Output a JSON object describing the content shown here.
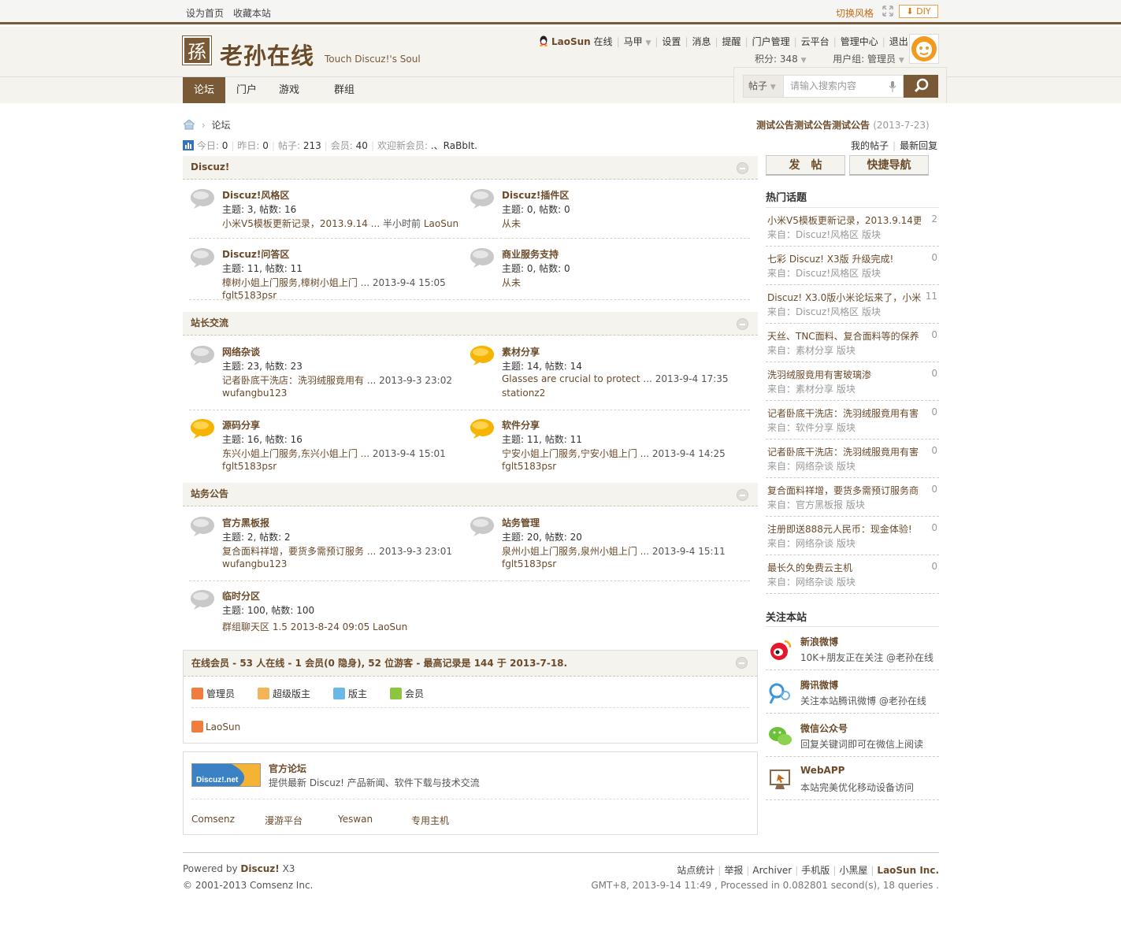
{
  "topbar": {
    "set_home": "设为首页",
    "bookmark": "收藏本站",
    "switch_style": "切换风格",
    "diy": "DIY"
  },
  "header": {
    "logo_char": "孫",
    "site_name": "老孙在线",
    "slogan": "Touch Discuz!'s Soul"
  },
  "usernav": {
    "username": "LaoSun",
    "status": "在线",
    "items": [
      "马甲",
      "设置",
      "消息",
      "提醒",
      "门户管理",
      "云平台",
      "管理中心",
      "退出"
    ],
    "points": "积分: 348",
    "group": "用户组: 管理员"
  },
  "nav": {
    "items": [
      "论坛",
      "门户",
      "游戏",
      "群组"
    ]
  },
  "search": {
    "type": "帖子",
    "placeholder": "请输入搜索内容"
  },
  "breadcrumb": {
    "current": "论坛"
  },
  "announcement": {
    "text": "测试公告测试公告测试公告",
    "date": "(2013-7-23)"
  },
  "stats": {
    "today_label": "今日:",
    "today": "0",
    "yesterday_label": "昨日:",
    "yesterday": "0",
    "posts_label": "帖子:",
    "posts": "213",
    "members_label": "会员:",
    "members": "40",
    "welcome_label": "欢迎新会员:",
    "newest": ".、RaBbIt."
  },
  "mylinks": {
    "my_posts": "我的帖子",
    "latest_replies": "最新回复"
  },
  "categories": [
    {
      "name": "Discuz!",
      "forums": [
        {
          "name": "Discuz!风格区",
          "counts": "主题: 3, 帖数: 16",
          "last": "小米V5模板更新记录，2013.9.14 ...",
          "time": "半小时前",
          "user": "LaoSun",
          "icon": "gray"
        },
        {
          "name": "Discuz!插件区",
          "counts": "主题: 0, 帖数: 0",
          "last": "从未",
          "time": "",
          "user": "",
          "icon": "gray"
        },
        {
          "name": "Discuz!问答区",
          "counts": "主题: 11, 帖数: 11",
          "last": "樟树小姐上门服务,樟树小姐上门 ...",
          "time": "2013-9-4 15:05",
          "user": "fglt5183psr",
          "icon": "gray"
        },
        {
          "name": "商业服务支持",
          "counts": "主题: 0, 帖数: 0",
          "last": "从未",
          "time": "",
          "user": "",
          "icon": "gray"
        }
      ]
    },
    {
      "name": "站长交流",
      "forums": [
        {
          "name": "网络杂谈",
          "counts": "主题: 23, 帖数: 23",
          "last": "记者卧底干洗店：洗羽绒服竟用有 ...",
          "time": "2013-9-3 23:02",
          "user": "wufangbu123",
          "icon": "gray"
        },
        {
          "name": "素材分享",
          "counts": "主题: 14, 帖数: 14",
          "last": "Glasses are crucial to protect ...",
          "time": "2013-9-4 17:35",
          "user": "stationz2",
          "icon": "yellow"
        },
        {
          "name": "源码分享",
          "counts": "主题: 16, 帖数: 16",
          "last": "东兴小姐上门服务,东兴小姐上门 ...",
          "time": "2013-9-4 15:01",
          "user": "fglt5183psr",
          "icon": "yellow"
        },
        {
          "name": "软件分享",
          "counts": "主题: 11, 帖数: 11",
          "last": "宁安小姐上门服务,宁安小姐上门 ...",
          "time": "2013-9-4 14:25",
          "user": "fglt5183psr",
          "icon": "yellow"
        }
      ]
    },
    {
      "name": "站务公告",
      "forums": [
        {
          "name": "官方黑板报",
          "counts": "主题: 2, 帖数: 2",
          "last": "复合面料祥增，要货多需预订服务 ...",
          "time": "2013-9-3 23:01",
          "user": "wufangbu123",
          "icon": "gray"
        },
        {
          "name": "站务管理",
          "counts": "主题: 20, 帖数: 20",
          "last": "泉州小姐上门服务,泉州小姐上门 ...",
          "time": "2013-9-4 15:11",
          "user": "fglt5183psr",
          "icon": "gray"
        },
        {
          "name": "临时分区",
          "counts": "主题: 100, 帖数: 100",
          "last": "群组聊天区 1.5",
          "time": "2013-8-24 09:05",
          "user": "LaoSun",
          "icon": "gray"
        }
      ]
    }
  ],
  "online": {
    "title": "在线会员 - 53 人在线 - 1 会员(0 隐身), 52 位游客 - 最高记录是 144 于 2013-7-18.",
    "roles": [
      "管理员",
      "超级版主",
      "版主",
      "会员"
    ],
    "users": [
      "LaoSun"
    ]
  },
  "links": {
    "logo_text": "Discuz!.net",
    "title": "官方论坛",
    "desc": "提供最新 Discuz! 产品新闻、软件下载与技术交流",
    "items": [
      "Comsenz",
      "漫游平台",
      "Yeswan",
      "专用主机"
    ]
  },
  "sidebar": {
    "post_btn": "发　帖",
    "quicknav_btn": "快捷导航",
    "hot_title": "热门话题",
    "hot": [
      {
        "title": "小米V5模板更新记录，2013.9.14更",
        "count": "2",
        "source": "来自：Discuz!风格区",
        "tag": "版块"
      },
      {
        "title": "七彩 Discuz! X3版 升级完成!",
        "count": "0",
        "source": "来自：Discuz!风格区",
        "tag": "版块"
      },
      {
        "title": "Discuz! X3.0版小米论坛来了，小米",
        "count": "11",
        "source": "来自：Discuz!风格区",
        "tag": "版块"
      },
      {
        "title": "天丝、TNC面料、复合面料等的保养",
        "count": "0",
        "source": "来自：素材分享",
        "tag": "版块"
      },
      {
        "title": "洗羽绒服竟用有害玻璃渗",
        "count": "0",
        "source": "来自：素材分享",
        "tag": "版块"
      },
      {
        "title": "记者卧底干洗店：洗羽绒服竟用有害",
        "count": "0",
        "source": "来自：软件分享",
        "tag": "版块"
      },
      {
        "title": "记者卧底干洗店：洗羽绒服竟用有害",
        "count": "0",
        "source": "来自：网络杂谈",
        "tag": "版块"
      },
      {
        "title": "复合面料祥增，要货多需预订服务商",
        "count": "0",
        "source": "来自：官方黑板报",
        "tag": "版块"
      },
      {
        "title": "注册即送888元人民币：现金体验!",
        "count": "0",
        "source": "来自：网络杂谈",
        "tag": "版块"
      },
      {
        "title": "最长久的免费云主机",
        "count": "0",
        "source": "来自：网络杂谈",
        "tag": "版块"
      }
    ],
    "follow_title": "关注本站",
    "follow": [
      {
        "name": "新浪微博",
        "desc": "10K+朋友正在关注 @老孙在线",
        "icon": "weibo-icon"
      },
      {
        "name": "腾讯微博",
        "desc": "关注本站腾讯微博 @老孙在线",
        "icon": "tencent-weibo-icon"
      },
      {
        "name": "微信公众号",
        "desc": "回复关键词即可在微信上阅读",
        "icon": "wechat-icon"
      },
      {
        "name": "WebAPP",
        "desc": "本站完美优化移动设备访问",
        "icon": "webapp-icon"
      }
    ]
  },
  "footer": {
    "powered": "Powered by",
    "brand": "Discuz!",
    "version": "X3",
    "copyright": "© 2001-2013 Comsenz Inc.",
    "links": [
      "站点统计",
      "举报",
      "Archiver",
      "手机版",
      "小黑屋"
    ],
    "company": "LaoSun Inc.",
    "info": "GMT+8, 2013-9-14 11:49 , Processed in 0.082801 second(s), 18 queries ."
  },
  "colors": {
    "brand": "#7a5a36",
    "link": "#6b4b2a",
    "accent": "#e3a54c"
  }
}
